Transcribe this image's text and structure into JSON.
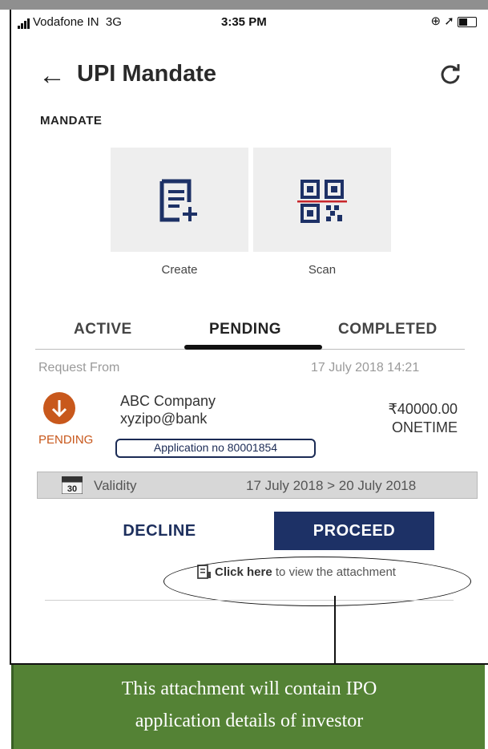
{
  "status_bar": {
    "carrier": "Vodafone IN",
    "network": "3G",
    "time": "3:35 PM"
  },
  "header": {
    "title": "UPI Mandate"
  },
  "mandate": {
    "section_label": "MANDATE",
    "create_label": "Create",
    "scan_label": "Scan"
  },
  "tabs": [
    {
      "label": "ACTIVE"
    },
    {
      "label": "PENDING"
    },
    {
      "label": "COMPLETED"
    }
  ],
  "active_tab": "PENDING",
  "request": {
    "from_label": "Request From",
    "datetime": "17 July 2018 14:21",
    "company": "ABC Company",
    "vpa": "xyzipo@bank",
    "amount": "₹40000.00",
    "frequency": "ONETIME",
    "status": "PENDING",
    "application_no": "Application no 80001854",
    "validity_label": "Validity",
    "validity_range": "17 July 2018 > 20 July 2018",
    "calendar_day": "30"
  },
  "actions": {
    "decline": "DECLINE",
    "proceed": "PROCEED"
  },
  "attachment": {
    "link_text": "Click here",
    "rest_text": "to view the attachment"
  },
  "callout": {
    "line1": "This attachment will contain IPO",
    "line2": "application details of investor"
  },
  "colors": {
    "accent_navy": "#1d3166",
    "pending_orange": "#c8581c",
    "callout_green": "#548235"
  }
}
